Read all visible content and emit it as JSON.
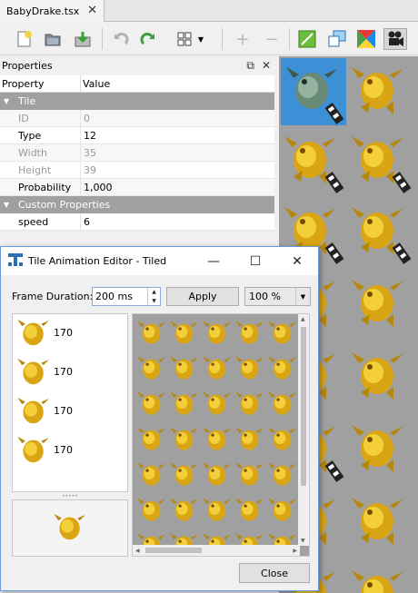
{
  "tab": {
    "title": "BabyDrake.tsx",
    "close": "✕"
  },
  "toolbar": {
    "icons": [
      "new-tileset-icon",
      "open-icon",
      "save-icon",
      "undo-icon",
      "redo-icon",
      "terrain-brush-icon",
      "add-tile-icon",
      "remove-tile-icon",
      "edit-collision-icon",
      "edit-animation-icon",
      "terrain-icon",
      "animation-camera-icon"
    ]
  },
  "properties": {
    "title": "Properties",
    "header": {
      "col1": "Property",
      "col2": "Value"
    },
    "group_tile": "Tile",
    "rows": [
      {
        "key": "ID",
        "value": "0",
        "disabled": true
      },
      {
        "key": "Type",
        "value": "12",
        "disabled": false
      },
      {
        "key": "Width",
        "value": "35",
        "disabled": true
      },
      {
        "key": "Height",
        "value": "39",
        "disabled": true
      },
      {
        "key": "Probability",
        "value": "1,000",
        "disabled": false
      }
    ],
    "group_custom": "Custom Properties",
    "custom_rows": [
      {
        "key": "speed",
        "value": "6"
      }
    ]
  },
  "dialog": {
    "title": "Tile Animation Editor - Tiled",
    "frame_duration_label": "Frame Duration:",
    "frame_duration_value": "200 ms",
    "apply_label": "Apply",
    "zoom_value": "100 %",
    "frames": [
      {
        "duration": "170"
      },
      {
        "duration": "170"
      },
      {
        "duration": "170"
      },
      {
        "duration": "170"
      }
    ],
    "close_label": "Close"
  },
  "colors": {
    "accent": "#3d8fd6",
    "group_header": "#a0a0a0",
    "gold": "#e0b020",
    "selection": "#3d8fd6"
  }
}
